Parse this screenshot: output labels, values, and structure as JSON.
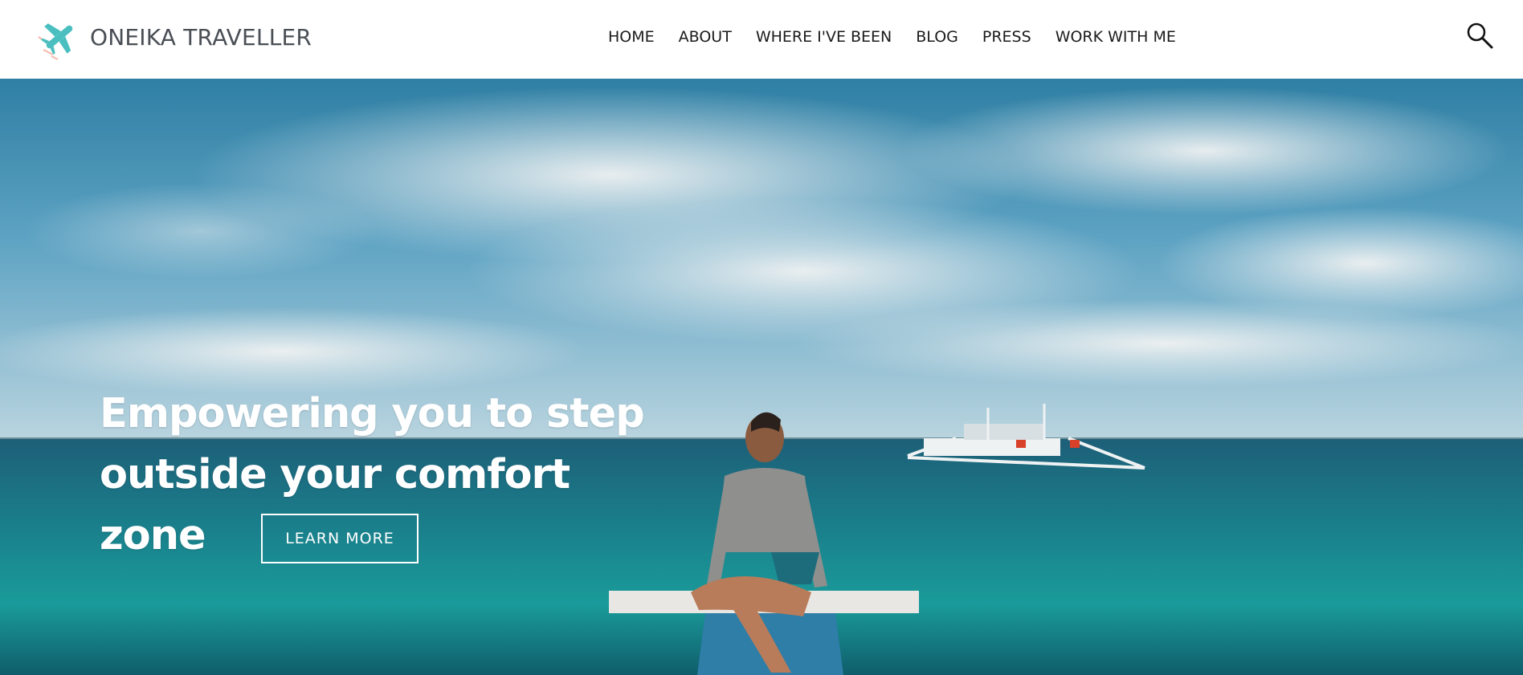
{
  "brand": {
    "name": "ONEIKA TRAVELLER",
    "accent_color": "#4bbfc0",
    "icon": "airplane-icon"
  },
  "nav": {
    "items": [
      {
        "label": "HOME"
      },
      {
        "label": "ABOUT"
      },
      {
        "label": "WHERE I'VE BEEN"
      },
      {
        "label": "BLOG"
      },
      {
        "label": "PRESS"
      },
      {
        "label": "WORK WITH ME"
      }
    ],
    "search_icon": "search-icon"
  },
  "hero": {
    "headline_line1": "Empowering you to step",
    "headline_line2": "outside your comfort zone",
    "cta_label": "LEARN MORE",
    "text_color": "#ffffff"
  }
}
